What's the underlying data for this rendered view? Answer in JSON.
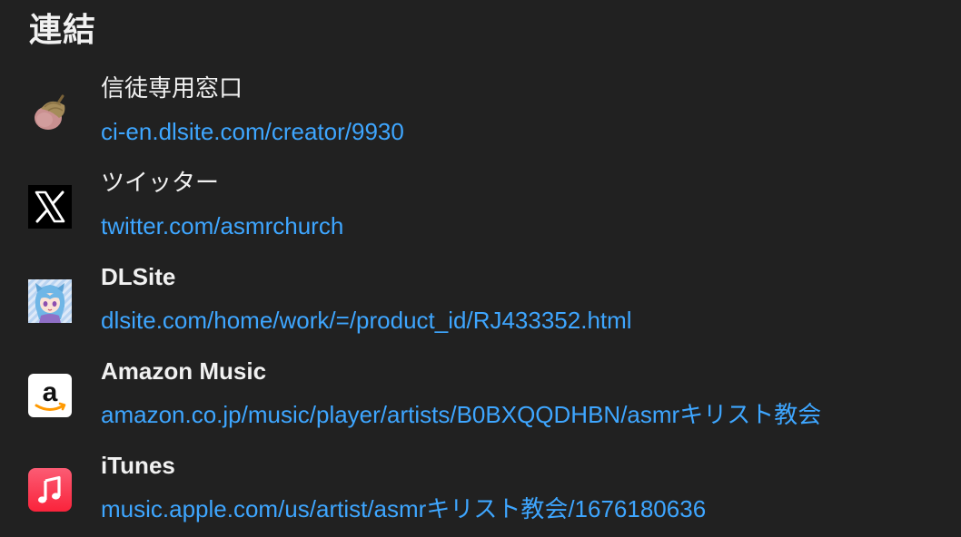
{
  "section": {
    "title": "連結"
  },
  "links": [
    {
      "title": "信徒専用窓口",
      "url": "ci-en.dlsite.com/creator/9930",
      "icon": "acorn-icon"
    },
    {
      "title": "ツイッター",
      "url": "twitter.com/asmrchurch",
      "icon": "x-logo-icon"
    },
    {
      "title": "DLSite",
      "url": "dlsite.com/home/work/=/product_id/RJ433352.html",
      "icon": "anime-character-avatar-icon"
    },
    {
      "title": "Amazon Music",
      "url": "amazon.co.jp/music/player/artists/B0BXQQDHBN/asmrキリスト教会",
      "icon": "amazon-logo-icon"
    },
    {
      "title": "iTunes",
      "url": "music.apple.com/us/artist/asmrキリスト教会/1676180636",
      "icon": "apple-music-icon"
    }
  ],
  "colors": {
    "background": "#212121",
    "text": "#f1f1f1",
    "link": "#3ea6ff"
  }
}
